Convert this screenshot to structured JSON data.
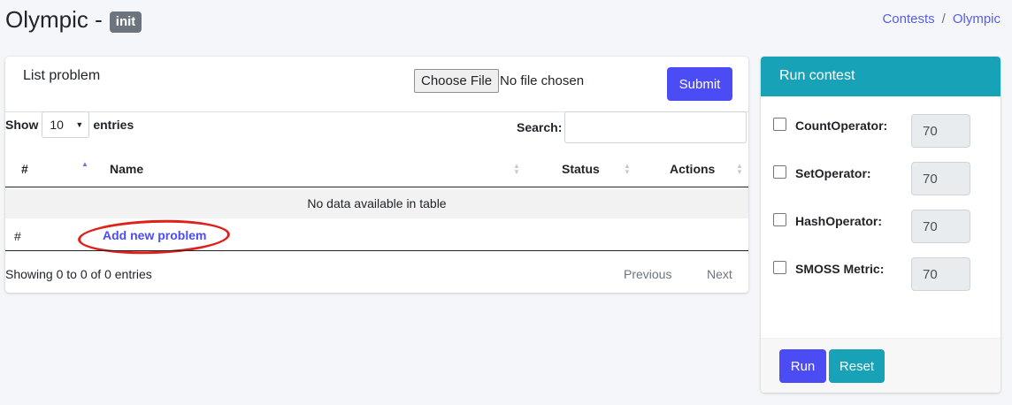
{
  "header": {
    "title": "Olympic -",
    "badge": "init",
    "breadcrumb": [
      "Contests",
      "/",
      "Olympic"
    ]
  },
  "list_card": {
    "title": "List problem",
    "choose_file_label": "Choose File",
    "file_status": "No file chosen",
    "submit_label": "Submit",
    "show_label": "Show",
    "entries_label": "entries",
    "page_size": "10",
    "search_label": "Search:",
    "search_value": "",
    "columns": [
      "#",
      "Name",
      "Status",
      "Actions"
    ],
    "empty_message": "No data available in table",
    "add_row_hash": "#",
    "add_link": "Add new problem",
    "info": "Showing 0 to 0 of 0 entries",
    "prev_label": "Previous",
    "next_label": "Next"
  },
  "run_card": {
    "title": "Run contest",
    "operators": [
      {
        "label": "CountOperator:",
        "value": "70",
        "checked": false
      },
      {
        "label": "SetOperator:",
        "value": "70",
        "checked": false
      },
      {
        "label": "HashOperator:",
        "value": "70",
        "checked": false
      },
      {
        "label": "SMOSS Metric:",
        "value": "70",
        "checked": false
      }
    ],
    "run_label": "Run",
    "reset_label": "Reset"
  },
  "colors": {
    "primary": "#4c4cf5",
    "info": "#17a2b8",
    "badge": "#6c757d",
    "annotation": "#e0201b"
  }
}
